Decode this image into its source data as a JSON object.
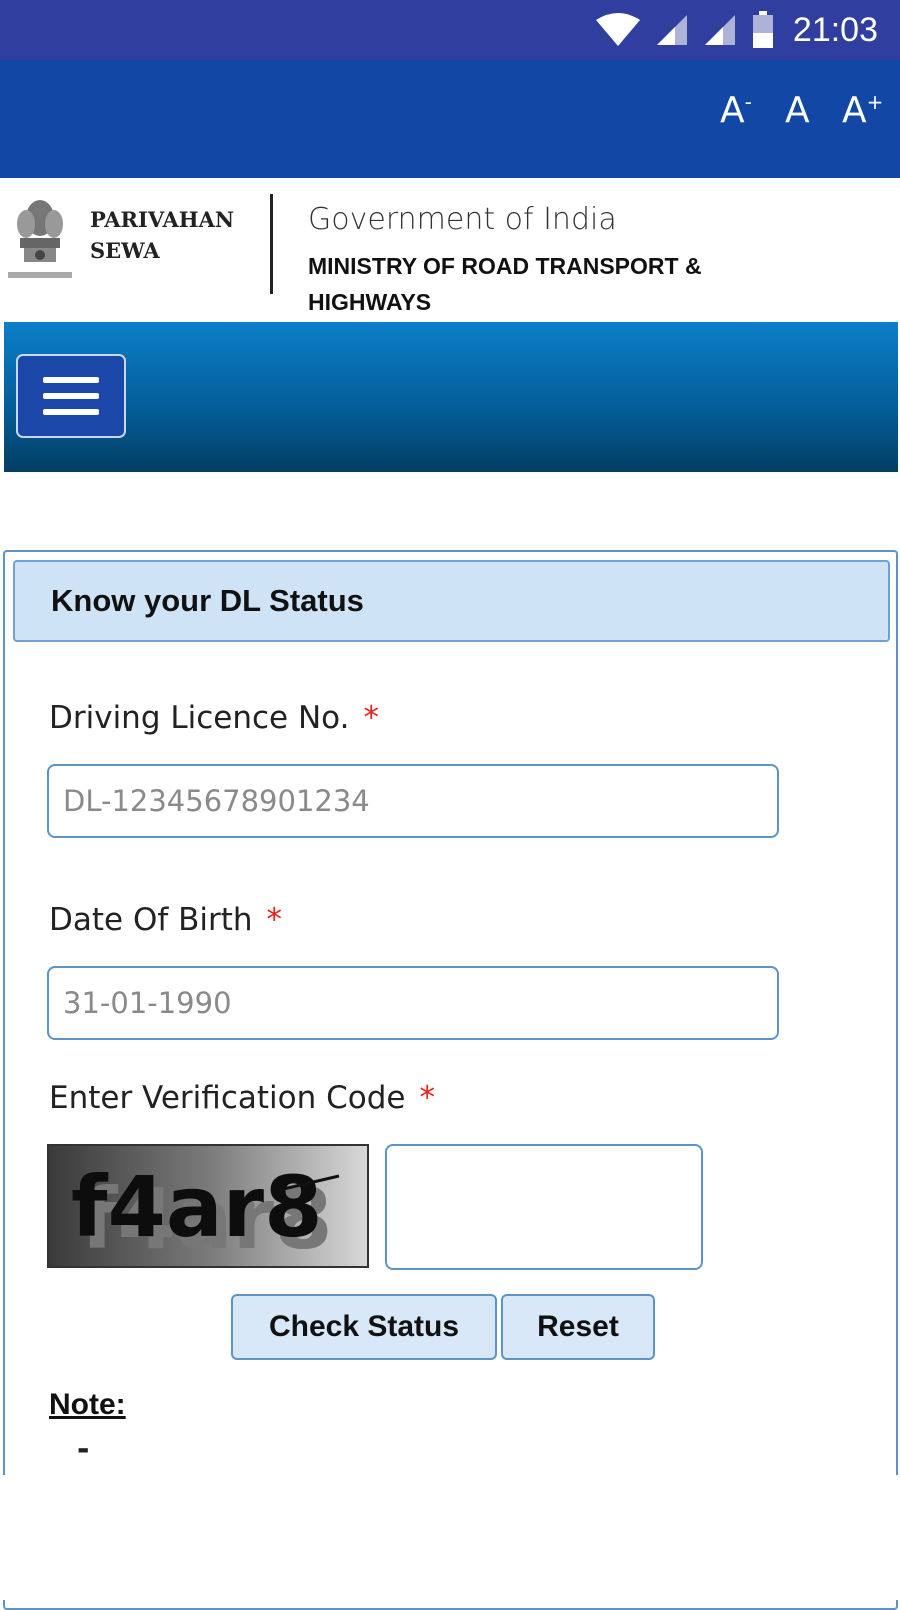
{
  "status_bar": {
    "time": "21:03",
    "icons": [
      "wifi-icon",
      "signal-icon",
      "signal-icon",
      "battery-icon"
    ]
  },
  "font_controls": {
    "decrease_base": "A",
    "decrease_sup": "-",
    "normal": "A",
    "increase_base": "A",
    "increase_sup": "+"
  },
  "header": {
    "brand_line1": "PARIVAHAN",
    "brand_line2": "SEWA",
    "government": "Government of India",
    "ministry": "MINISTRY OF ROAD TRANSPORT & HIGHWAYS",
    "emblem_icon": "state-emblem-icon"
  },
  "nav": {
    "menu_icon": "hamburger-menu-icon"
  },
  "form": {
    "title": "Know your DL Status",
    "dl_label": "Driving Licence No.",
    "dl_placeholder": "DL-12345678901234",
    "dob_label": "Date Of Birth",
    "dob_placeholder": "31-01-1990",
    "captcha_label": "Enter Verification Code",
    "captcha_text": "f4ar8",
    "required_mark": "*",
    "check_button": "Check Status",
    "reset_button": "Reset",
    "note_label": "Note:",
    "note_item": "-"
  },
  "colors": {
    "status_bar": "#303f9f",
    "top_bar": "#1247a6",
    "nav_gradient_top": "#0a7fc9",
    "nav_gradient_bottom": "#023e63",
    "panel_heading": "#cfe3f7",
    "border": "#5a94c8",
    "required": "#e8201c"
  }
}
